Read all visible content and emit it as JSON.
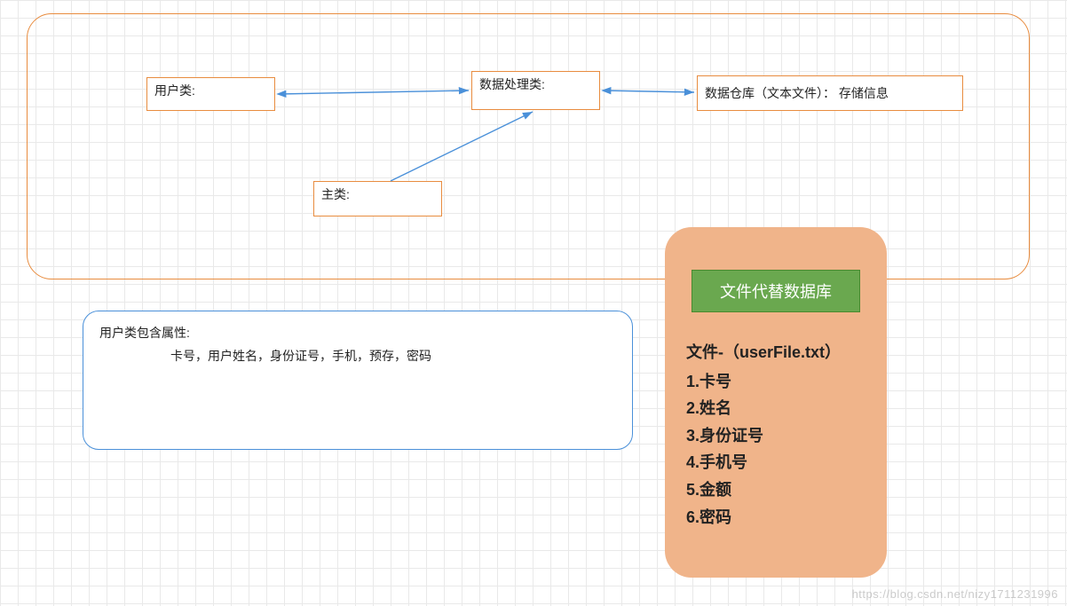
{
  "outer": {
    "nodes": {
      "user": {
        "label": "用户类:"
      },
      "proc": {
        "label": "数据处理类:"
      },
      "store": {
        "label": "数据仓库（文本文件）： 存储信息"
      },
      "main": {
        "label": "主类:"
      }
    }
  },
  "attributes": {
    "title": "用户类包含属性:",
    "body": "卡号，用户姓名，身份证号，手机，预存，密码"
  },
  "file_panel": {
    "title": "文件代替数据库",
    "heading": "文件-（userFile.txt）",
    "items": [
      "1.卡号",
      "2.姓名",
      "3.身份证号",
      "4.手机号",
      "5.金额",
      "6.密码"
    ]
  },
  "arrows": {
    "color": "#4a90d9"
  },
  "watermark": "https://blog.csdn.net/nizy1711231996"
}
